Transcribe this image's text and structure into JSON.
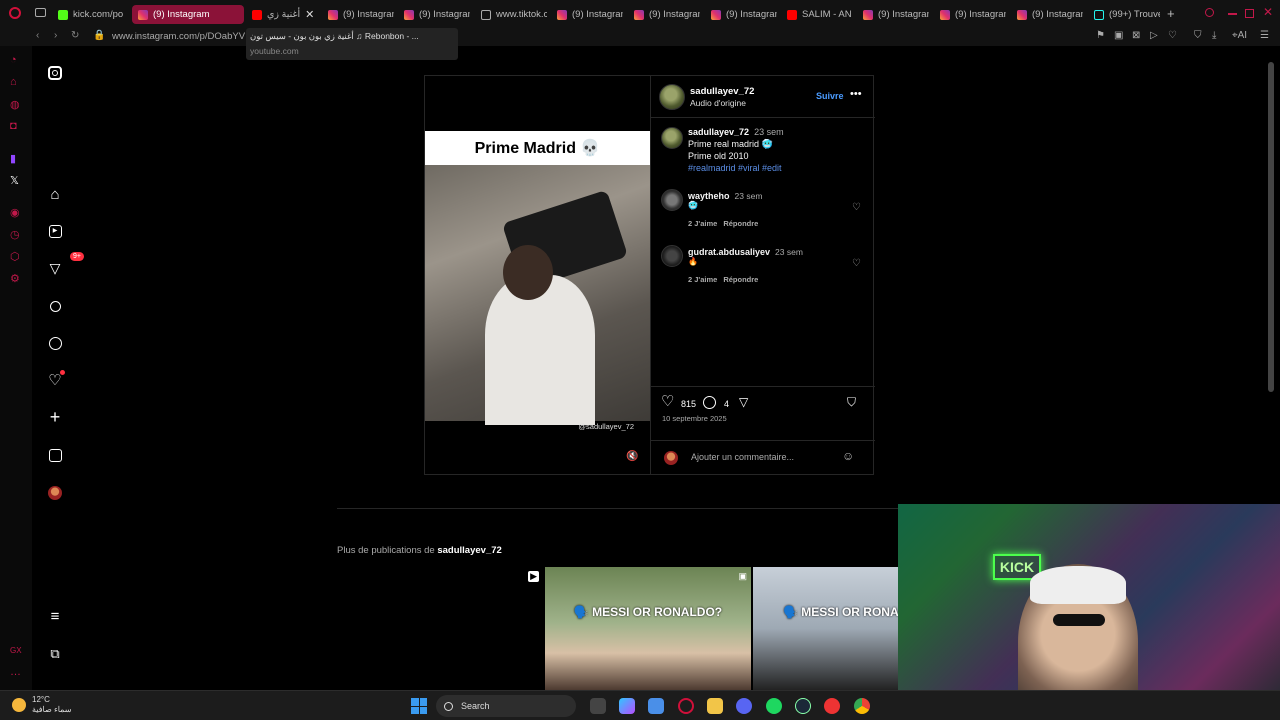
{
  "browser": {
    "tabs": [
      {
        "label": "kick.com/po",
        "icon": "kick-icon"
      },
      {
        "label": "(9) Instagram",
        "icon": "instagram-icon",
        "active": true
      },
      {
        "label": "أغنية زي",
        "icon": "youtube-icon"
      },
      {
        "label": "(9) Instagram",
        "icon": "instagram-icon"
      },
      {
        "label": "(9) Instagram",
        "icon": "instagram-icon"
      },
      {
        "label": "www.tiktok.c",
        "icon": "document-icon"
      },
      {
        "label": "(9) Instagram",
        "icon": "instagram-icon"
      },
      {
        "label": "(9) Instagram",
        "icon": "instagram-icon"
      },
      {
        "label": "(9) Instagram",
        "icon": "instagram-icon"
      },
      {
        "label": "SALIM - AN",
        "icon": "youtube-icon"
      },
      {
        "label": "(9) Instagram",
        "icon": "instagram-icon"
      },
      {
        "label": "(9) Instagram",
        "icon": "instagram-icon"
      },
      {
        "label": "(9) Instagram",
        "icon": "instagram-icon"
      },
      {
        "label": "(99+) Trouve",
        "icon": "tiktok-icon"
      }
    ],
    "new_tab_label": "+",
    "url": "www.instagram.com/p/DOabYV",
    "tooltip": {
      "title": "أغنية زي بون بون - سيس تون ♫ Rebonbon - ...",
      "domain": "youtube.com"
    }
  },
  "instagram": {
    "nav_badge": "9+",
    "post": {
      "video_title": "Prime Madrid 💀",
      "watermark": "@sadullayev_72",
      "author": "sadullayev_72",
      "audio": "Audio d'origine",
      "follow_label": "Suivre",
      "caption": {
        "user": "sadullayev_72",
        "time": "23 sem",
        "line1": "Prime real madrid 🥶",
        "line2": "Prime old 2010",
        "hashtags": "#realmadrid #viral #edit"
      },
      "comments": [
        {
          "user": "waytheho",
          "time": "23 sem",
          "text": "🥶",
          "likes": "2 J'aime",
          "reply": "Répondre"
        },
        {
          "user": "gudrat.abdusaliyev",
          "time": "23 sem",
          "text": "🔥",
          "likes": "2 J'aime",
          "reply": "Répondre"
        }
      ],
      "like_count": "815",
      "comment_count": "4",
      "date": "10 septembre 2025",
      "add_comment_placeholder": "Ajouter un commentaire..."
    },
    "more_posts": {
      "prefix": "Plus de publications de",
      "user": "sadullayev_72",
      "thumbs": [
        {
          "overlay": ""
        },
        {
          "overlay": "🗣️ MESSI OR RONALDO?"
        },
        {
          "overlay": "🗣️ MESSI OR RONA"
        }
      ]
    }
  },
  "taskbar": {
    "temperature": "12°C",
    "condition": "سماء صافية",
    "search_label": "Search"
  },
  "colors": {
    "active_tab": "#8b1238",
    "follow_blue": "#4a9bff",
    "hashtag": "#5b8ee6",
    "opera_red": "#c2184a"
  }
}
